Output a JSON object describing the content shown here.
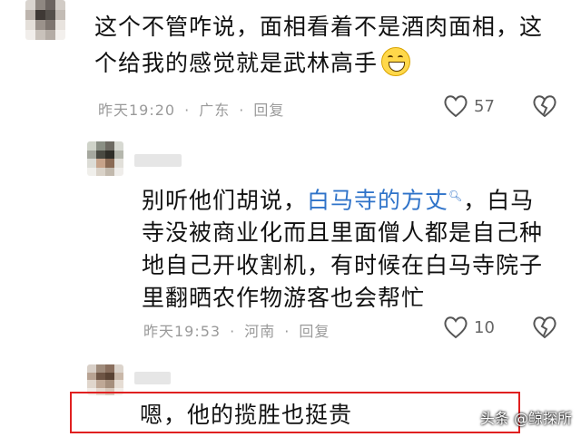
{
  "comment1": {
    "line1": "这个不管咋说，面相看着不是酒肉面相，这",
    "line2": "个给我的感觉就是武林高手",
    "emoji": "grinning-face-emoji",
    "time": "昨天19:20",
    "location": "广东",
    "reply": "回复",
    "likes": "57"
  },
  "reply1": {
    "line1_pre": "别听他们胡说，",
    "line1_link": "白马寺的方丈",
    "line1_post": "，白马",
    "line2": "寺没被商业化而且里面僧人都是自己种",
    "line3": "地自己开收割机，有时候在白马寺院子",
    "line4": "里翻晒农作物游客也会帮忙",
    "time": "昨天19:53",
    "location": "河南",
    "reply": "回复",
    "likes": "10"
  },
  "reply2": {
    "text": "嗯，他的揽胜也挺贵"
  },
  "watermark": "头条 @鲸探所",
  "colors": {
    "link": "#2f73c9",
    "highlight": "#e02020",
    "meta": "#9a9a9a"
  }
}
